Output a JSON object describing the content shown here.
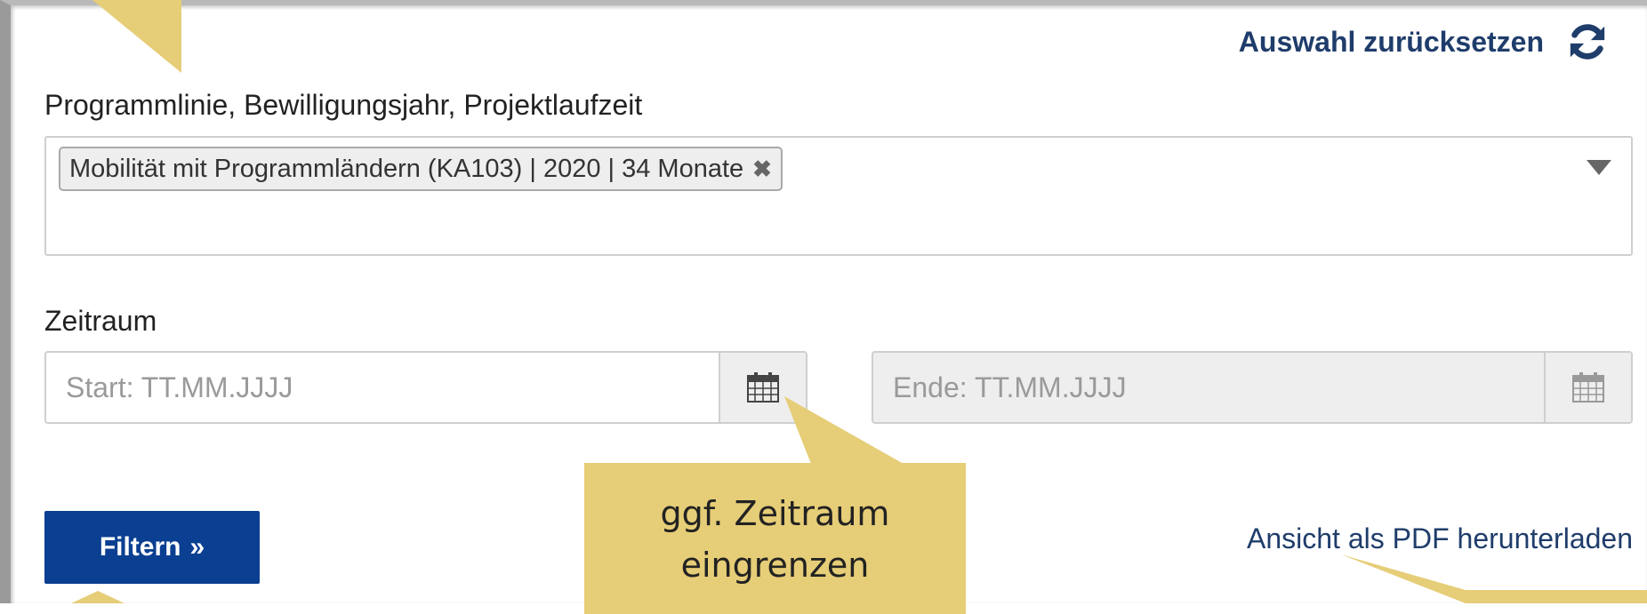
{
  "reset": {
    "label": "Auswahl zurücksetzen",
    "icon": "refresh-icon"
  },
  "program": {
    "label": "Programmlinie, Bewilligungsjahr, Projektlaufzeit",
    "selected_tag": "Mobilität mit Programmländern (KA103) | 2020 | 34 Monate",
    "remove_icon": "✖"
  },
  "period": {
    "label": "Zeitraum",
    "start_placeholder": "Start: TT.MM.JJJJ",
    "end_placeholder": "Ende: TT.MM.JJJJ"
  },
  "actions": {
    "filter_label": "Filtern",
    "filter_icon": "»",
    "pdf_link": "Ansicht als PDF herunterladen"
  },
  "callout": {
    "line1": "ggf. Zeitraum",
    "line2": "eingrenzen"
  },
  "colors": {
    "primary_blue": "#0b3f91",
    "link_blue": "#1f3d6b",
    "callout_yellow": "#e6cd77"
  }
}
